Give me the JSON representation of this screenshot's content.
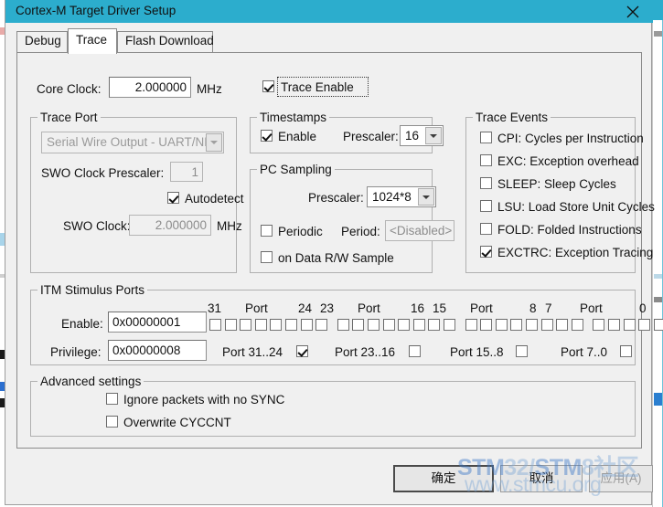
{
  "window": {
    "title": "Cortex-M Target Driver Setup",
    "close_icon": "close-icon",
    "titlebar_color": "#2cadcd",
    "body_color": "#f0f0f0"
  },
  "tabs": [
    {
      "label": "Debug",
      "active": false
    },
    {
      "label": "Trace",
      "active": true
    },
    {
      "label": "Flash Download",
      "active": false
    }
  ],
  "core_clock": {
    "label": "Core Clock:",
    "value": "2.000000",
    "unit": "MHz"
  },
  "trace_enable": {
    "label": "Trace Enable",
    "checked": true
  },
  "trace_port": {
    "title": "Trace Port",
    "port_select": {
      "value": "Serial Wire Output - UART/NRZ",
      "enabled": false
    },
    "swo_prescaler": {
      "label": "SWO Clock Prescaler:",
      "value": "1",
      "enabled": false
    },
    "autodetect": {
      "label": "Autodetect",
      "checked": true
    },
    "swo_clock": {
      "label": "SWO Clock:",
      "value": "2.000000",
      "unit": "MHz",
      "enabled": false
    }
  },
  "timestamps": {
    "title": "Timestamps",
    "enable": {
      "label": "Enable",
      "checked": true
    },
    "prescaler": {
      "label": "Prescaler:",
      "value": "16"
    }
  },
  "pc_sampling": {
    "title": "PC Sampling",
    "prescaler": {
      "label": "Prescaler:",
      "value": "1024*8"
    },
    "periodic": {
      "label": "Periodic",
      "checked": false
    },
    "period": {
      "label": "Period:",
      "value": "<Disabled>"
    },
    "on_data_rw": {
      "label": "on Data R/W Sample",
      "checked": false
    }
  },
  "trace_events": {
    "title": "Trace Events",
    "items": [
      {
        "label": "CPI: Cycles per Instruction",
        "checked": false
      },
      {
        "label": "EXC: Exception overhead",
        "checked": false
      },
      {
        "label": "SLEEP: Sleep Cycles",
        "checked": false
      },
      {
        "label": "LSU: Load Store Unit Cycles",
        "checked": false
      },
      {
        "label": "FOLD: Folded Instructions",
        "checked": false
      },
      {
        "label": "EXCTRC: Exception Tracing",
        "checked": true
      }
    ]
  },
  "itm_stimulus_ports": {
    "title": "ITM Stimulus Ports",
    "enable": {
      "label": "Enable:",
      "value": "0x00000001"
    },
    "privilege": {
      "label": "Privilege:",
      "value": "0x00000008"
    },
    "scale_labels": [
      {
        "hi": "31",
        "mid": "Port",
        "lo": "24"
      },
      {
        "hi": "23",
        "mid": "Port",
        "lo": "16"
      },
      {
        "hi": "15",
        "mid": "Port",
        "lo": "8"
      },
      {
        "hi": "7",
        "mid": "Port",
        "lo": "0"
      }
    ],
    "port_bits_checked": [
      false,
      false,
      false,
      false,
      false,
      false,
      false,
      false,
      false,
      false,
      false,
      false,
      false,
      false,
      false,
      false,
      false,
      false,
      false,
      false,
      false,
      false,
      false,
      false,
      false,
      false,
      false,
      false,
      false,
      false,
      false,
      true
    ],
    "group_toggles": [
      {
        "label": "Port 31..24",
        "checked": true
      },
      {
        "label": "Port 23..16",
        "checked": false
      },
      {
        "label": "Port 15..8",
        "checked": false
      },
      {
        "label": "Port 7..0",
        "checked": false
      }
    ]
  },
  "advanced_settings": {
    "title": "Advanced settings",
    "items": [
      {
        "label": "Ignore packets with no SYNC",
        "checked": false
      },
      {
        "label": "Overwrite CYCCNT",
        "checked": false
      }
    ]
  },
  "buttons": {
    "ok": "确定",
    "cancel": "取消",
    "apply": "应用(A)"
  },
  "watermark": {
    "line1_a": "STM",
    "line1_b": "32/",
    "line1_c": "STM",
    "line1_d": "8社区",
    "line2": "www.stmcu.org"
  }
}
